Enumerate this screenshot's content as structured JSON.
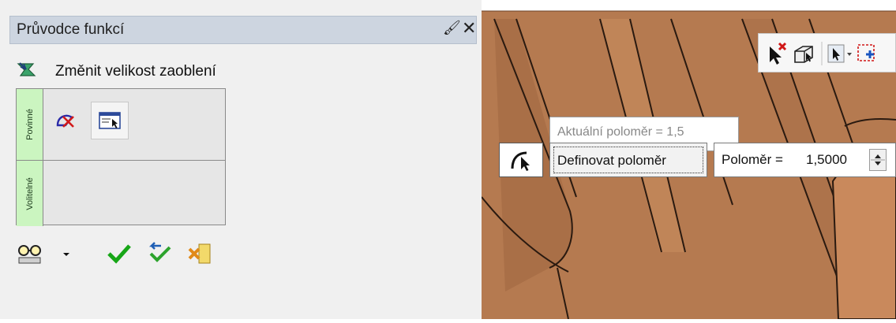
{
  "panel": {
    "title": "Průvodce funkcí",
    "pin_icon": "pin-icon",
    "close_icon": "close-icon",
    "command": {
      "icon": "fillet-resize-icon",
      "label": "Změnit velikost zaoblení"
    },
    "sections": [
      {
        "label": "Povinné",
        "tools": [
          "select-edge-icon",
          "dialog-select-icon"
        ]
      },
      {
        "label": "Volitelné",
        "tools": []
      }
    ],
    "bottom_buttons": [
      "preview-icon",
      "dropdown-arrow-icon",
      "ok-icon",
      "apply-icon",
      "cancel-icon"
    ]
  },
  "viewport": {
    "background_color": "#b57a50",
    "minitoolbar_icons": [
      "deselect-icon",
      "view-box-icon",
      "select-filter-icon",
      "dropdown-arrow-icon",
      "add-selection-icon"
    ],
    "tooltip": "Aktuální poloměr = 1,5",
    "define_button": "Definovat poloměr",
    "radius_label": "Poloměr =",
    "radius_value": "1,5000"
  }
}
